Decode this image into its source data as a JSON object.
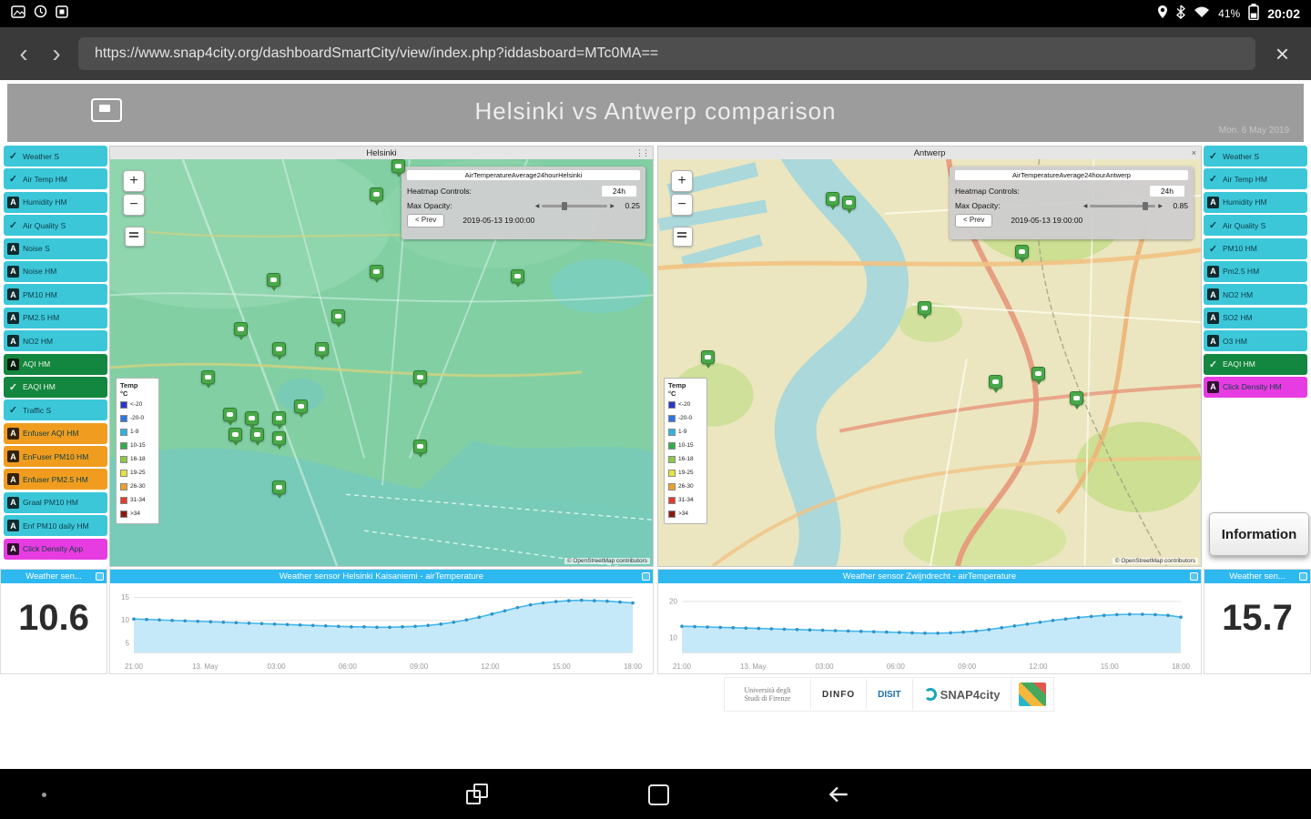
{
  "colors": {
    "cyan": "#3cc7d9",
    "green": "#13863f",
    "orange": "#f09d1f",
    "magenta": "#e73ce1",
    "chart_header": "#2eb8f0"
  },
  "status_bar": {
    "time": "20:02",
    "battery": "41%"
  },
  "browser": {
    "url": "https://www.snap4city.org/dashboardSmartCity/view/index.php?iddasboard=MTc0MA=="
  },
  "header": {
    "title": "Helsinki vs Antwerp comparison",
    "date": "Mon. 6 May 2019"
  },
  "icons": {
    "close": "×",
    "drag": "⋮⋮",
    "slider_left": "◀",
    "slider_right": "▶",
    "back": "‹",
    "forward": "›"
  },
  "map_controls": {
    "zoom_in": "+",
    "zoom_out": "−"
  },
  "left_sidebar": {
    "items": [
      {
        "label": "Weather S",
        "color": "cyan",
        "icon": "check"
      },
      {
        "label": "Air Temp HM",
        "color": "cyan",
        "icon": "check"
      },
      {
        "label": "Humidity HM",
        "color": "cyan",
        "icon": "a"
      },
      {
        "label": "Air Quality S",
        "color": "cyan",
        "icon": "check"
      },
      {
        "label": "Noise S",
        "color": "cyan",
        "icon": "a"
      },
      {
        "label": "Noise HM",
        "color": "cyan",
        "icon": "a"
      },
      {
        "label": "PM10 HM",
        "color": "cyan",
        "icon": "a"
      },
      {
        "label": "PM2.5 HM",
        "color": "cyan",
        "icon": "a"
      },
      {
        "label": "NO2 HM",
        "color": "cyan",
        "icon": "a"
      },
      {
        "label": "AQI HM",
        "color": "green",
        "icon": "a"
      },
      {
        "label": "EAQI HM",
        "color": "green",
        "icon": "check"
      },
      {
        "label": "Traffic S",
        "color": "cyan",
        "icon": "check"
      },
      {
        "label": "Enfuser AQI HM",
        "color": "orange",
        "icon": "a"
      },
      {
        "label": "EnFuser PM10 HM",
        "color": "orange",
        "icon": "a"
      },
      {
        "label": "Enfuser PM2.5 HM",
        "color": "orange",
        "icon": "a"
      },
      {
        "label": "Graal PM10 HM",
        "color": "cyan",
        "icon": "a"
      },
      {
        "label": "Enf PM10 daily HM",
        "color": "cyan",
        "icon": "a"
      },
      {
        "label": "Click Density App",
        "color": "magenta",
        "icon": "a"
      }
    ]
  },
  "right_sidebar": {
    "items": [
      {
        "label": "Weather S",
        "color": "cyan",
        "icon": "check"
      },
      {
        "label": "Air Temp HM",
        "color": "cyan",
        "icon": "check"
      },
      {
        "label": "Humidity HM",
        "color": "cyan",
        "icon": "a"
      },
      {
        "label": "Air Quality S",
        "color": "cyan",
        "icon": "check"
      },
      {
        "label": "PM10 HM",
        "color": "cyan",
        "icon": "check"
      },
      {
        "label": "Pm2.5 HM",
        "color": "cyan",
        "icon": "a"
      },
      {
        "label": "NO2 HM",
        "color": "cyan",
        "icon": "a"
      },
      {
        "label": "SO2 HM",
        "color": "cyan",
        "icon": "a"
      },
      {
        "label": "O3 HM",
        "color": "cyan",
        "icon": "a"
      },
      {
        "label": "EAQI HM",
        "color": "green",
        "icon": "check"
      },
      {
        "label": "Click Density HM",
        "color": "magenta",
        "icon": "a"
      }
    ]
  },
  "maps": {
    "helsinki": {
      "title": "Helsinki",
      "heatmap_name": "AirTemperatureAverage24hourHelsinki",
      "controls_label": "Heatmap Controls:",
      "controls_value": "24h",
      "opacity_label": "Max Opacity:",
      "opacity_value": "0.25",
      "prev_label": "< Prev",
      "timestamp": "2019-05-13 19:00:00",
      "attribution": "© OpenStreetMap contributors",
      "markers": [
        [
          53,
          4
        ],
        [
          49,
          11
        ],
        [
          30,
          32
        ],
        [
          49,
          30
        ],
        [
          75,
          31
        ],
        [
          24,
          44
        ],
        [
          42,
          41
        ],
        [
          31,
          49
        ],
        [
          39,
          49
        ],
        [
          57,
          56
        ],
        [
          18,
          56
        ],
        [
          22,
          65
        ],
        [
          26,
          66
        ],
        [
          31,
          66
        ],
        [
          23,
          70
        ],
        [
          27,
          70
        ],
        [
          31,
          71
        ],
        [
          35,
          63
        ],
        [
          57,
          73
        ],
        [
          31,
          83
        ]
      ]
    },
    "antwerp": {
      "title": "Antwerp",
      "heatmap_name": "AirTemperatureAverage24hourAntwerp",
      "controls_label": "Heatmap Controls:",
      "controls_value": "24h",
      "opacity_label": "Max Opacity:",
      "opacity_value": "0.85",
      "prev_label": "< Prev",
      "timestamp": "2019-05-13 19:00:00",
      "attribution": "© OpenStreetMap contributors",
      "markers": [
        [
          32,
          12
        ],
        [
          35,
          13
        ],
        [
          67,
          25
        ],
        [
          49,
          39
        ],
        [
          9,
          51
        ],
        [
          62,
          57
        ],
        [
          70,
          55
        ],
        [
          77,
          61
        ]
      ]
    }
  },
  "legend": {
    "title": "Temp",
    "unit": "°C",
    "items": [
      {
        "label": "<-20",
        "color": "#2b35c8"
      },
      {
        "label": "-20-0",
        "color": "#2f74e0"
      },
      {
        "label": "1-9",
        "color": "#2fb3e0"
      },
      {
        "label": "10-15",
        "color": "#2fae4a"
      },
      {
        "label": "16-18",
        "color": "#8ec943"
      },
      {
        "label": "19-25",
        "color": "#e8e23a"
      },
      {
        "label": "26-30",
        "color": "#efa02f"
      },
      {
        "label": "31-34",
        "color": "#e03b2f"
      },
      {
        "label": ">34",
        "color": "#8c1a12"
      }
    ]
  },
  "metrics": {
    "left": {
      "header": "Weather sen...",
      "value": "10.6"
    },
    "right": {
      "header": "Weather sen...",
      "value": "15.7"
    }
  },
  "information_button": "Information",
  "chart_data": [
    {
      "type": "area",
      "title": "Weather sensor Helsinki Kaisaniemi - airTemperature",
      "x_ticks": [
        "21:00",
        "13. May",
        "03:00",
        "06:00",
        "09:00",
        "12:00",
        "15:00",
        "18:00"
      ],
      "y_ticks": [
        5,
        10,
        15
      ],
      "ylim": [
        3,
        16.5
      ],
      "values": [
        10.3,
        10.2,
        10.1,
        10,
        9.9,
        9.8,
        9.7,
        9.6,
        9.5,
        9.4,
        9.3,
        9.2,
        9.1,
        9,
        8.9,
        8.8,
        8.7,
        8.6,
        8.6,
        8.5,
        8.5,
        8.6,
        8.7,
        8.9,
        9.2,
        9.6,
        10.1,
        10.7,
        11.4,
        12.1,
        12.8,
        13.4,
        13.8,
        14.1,
        14.3,
        14.4,
        14.3,
        14.2,
        14,
        13.8
      ]
    },
    {
      "type": "area",
      "title": "Weather sensor Zwijndrecht - airTemperature",
      "x_ticks": [
        "21:00",
        "13. May",
        "03:00",
        "06:00",
        "09:00",
        "12:00",
        "15:00",
        "18:00"
      ],
      "y_ticks": [
        10,
        20
      ],
      "ylim": [
        6,
        23
      ],
      "values": [
        13.2,
        13.1,
        13,
        12.9,
        12.8,
        12.7,
        12.6,
        12.5,
        12.4,
        12.3,
        12.2,
        12.1,
        12,
        11.9,
        11.8,
        11.7,
        11.6,
        11.5,
        11.4,
        11.3,
        11.3,
        11.4,
        11.6,
        11.9,
        12.3,
        12.8,
        13.3,
        13.8,
        14.3,
        14.8,
        15.2,
        15.6,
        15.9,
        16.2,
        16.4,
        16.5,
        16.5,
        16.4,
        16.2,
        15.7
      ]
    }
  ],
  "footer": {
    "logos": [
      "Università degli Studi di Firenze",
      "DINFO",
      "DISIT",
      "SNAP4city"
    ]
  }
}
